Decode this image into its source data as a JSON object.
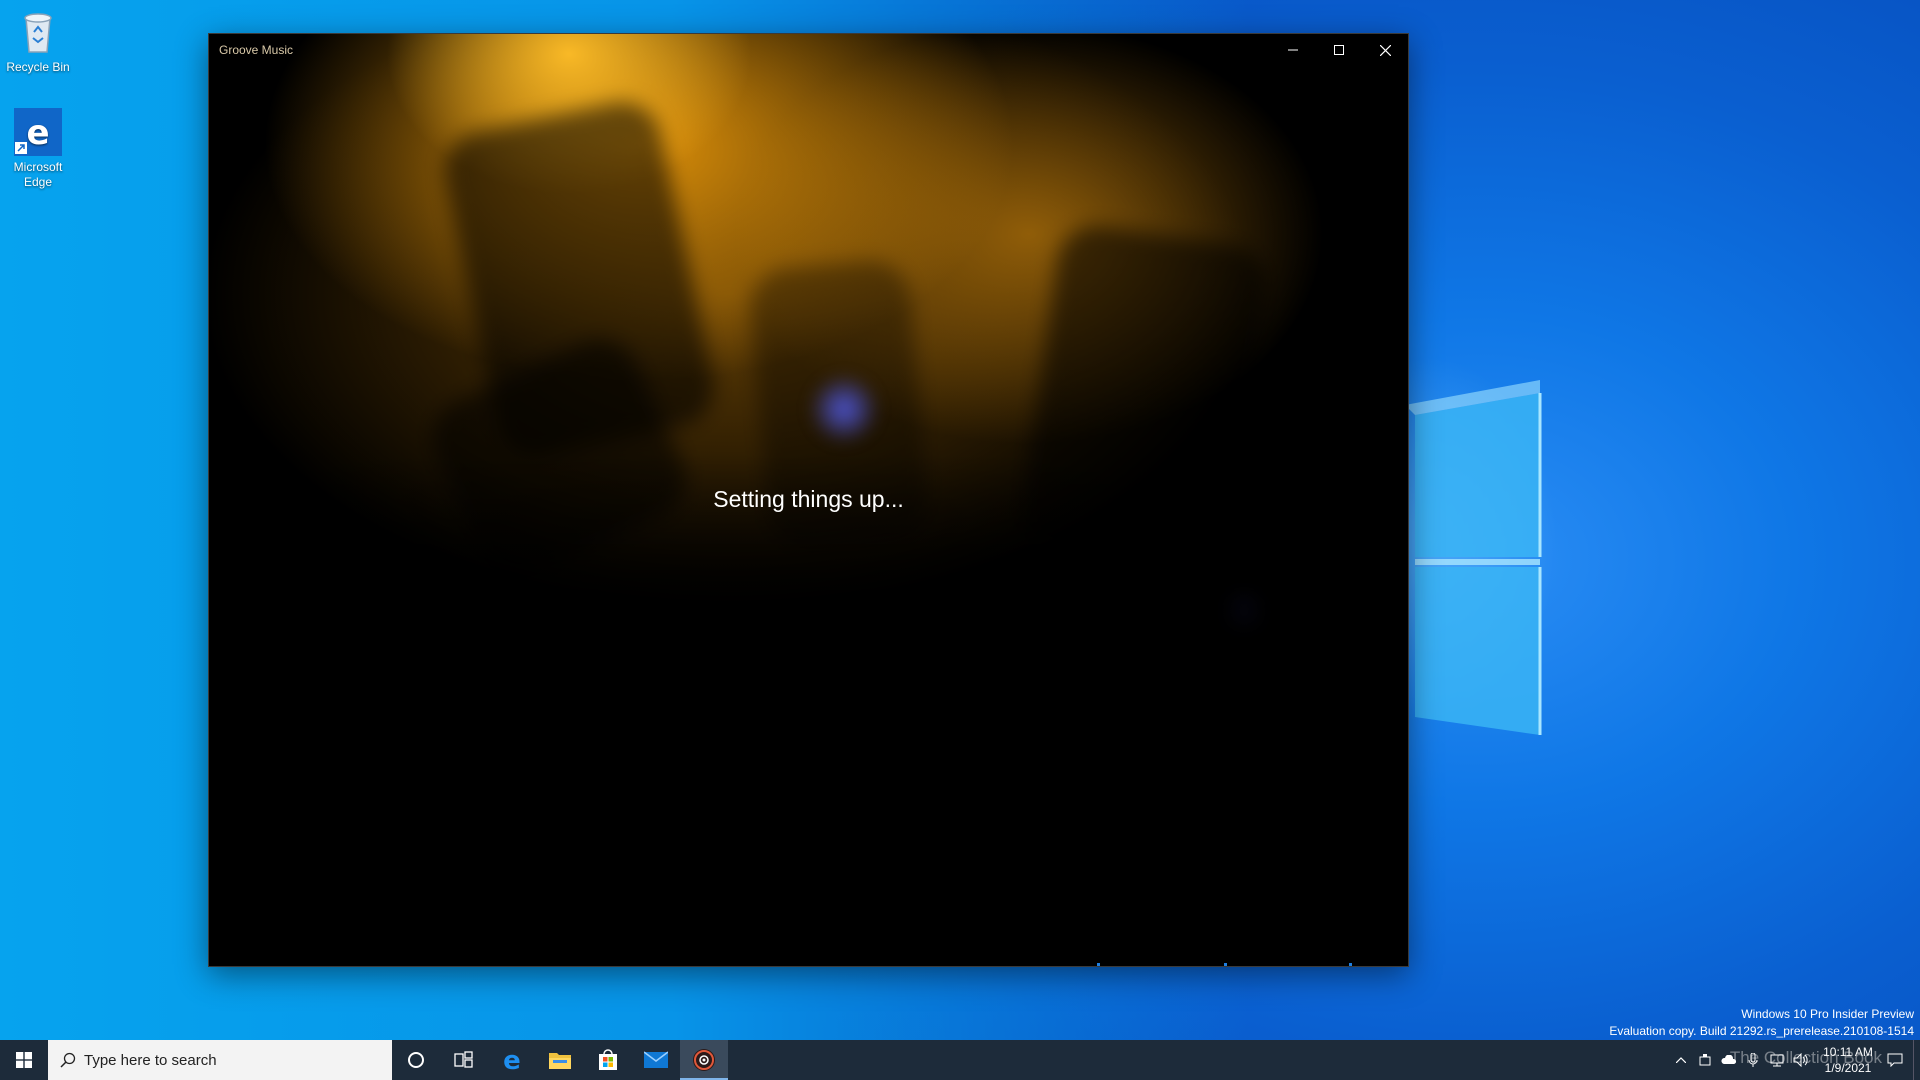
{
  "desktop": {
    "icons": [
      {
        "label": "Recycle Bin",
        "icon": "recycle-bin-icon"
      },
      {
        "label": "Microsoft Edge",
        "icon": "edge-icon"
      }
    ],
    "watermark": {
      "line1": "Windows 10 Pro Insider Preview",
      "line2": "Evaluation copy. Build 21292.rs_prerelease.210108-1514"
    }
  },
  "window": {
    "title": "Groove Music",
    "status_text": "Setting things up...",
    "controls": {
      "minimize": "minimize-icon",
      "maximize": "maximize-icon",
      "close": "close-icon"
    }
  },
  "taskbar": {
    "search_placeholder": "Type here to search",
    "pinned": [
      {
        "name": "cortana",
        "icon": "cortana-icon"
      },
      {
        "name": "task-view",
        "icon": "task-view-icon"
      },
      {
        "name": "edge",
        "icon": "edge-icon"
      },
      {
        "name": "file-explorer",
        "icon": "folder-icon"
      },
      {
        "name": "store",
        "icon": "store-icon"
      },
      {
        "name": "mail",
        "icon": "mail-icon"
      },
      {
        "name": "groove-music",
        "icon": "groove-music-icon",
        "active": true
      }
    ],
    "tray": {
      "time": "10:11 AM",
      "date": "1/9/2021",
      "overlay": "The Collection Book"
    }
  },
  "colors": {
    "taskbar": "#1d2b3a",
    "accent": "#0078d7",
    "desktop": "#0a78e0"
  }
}
